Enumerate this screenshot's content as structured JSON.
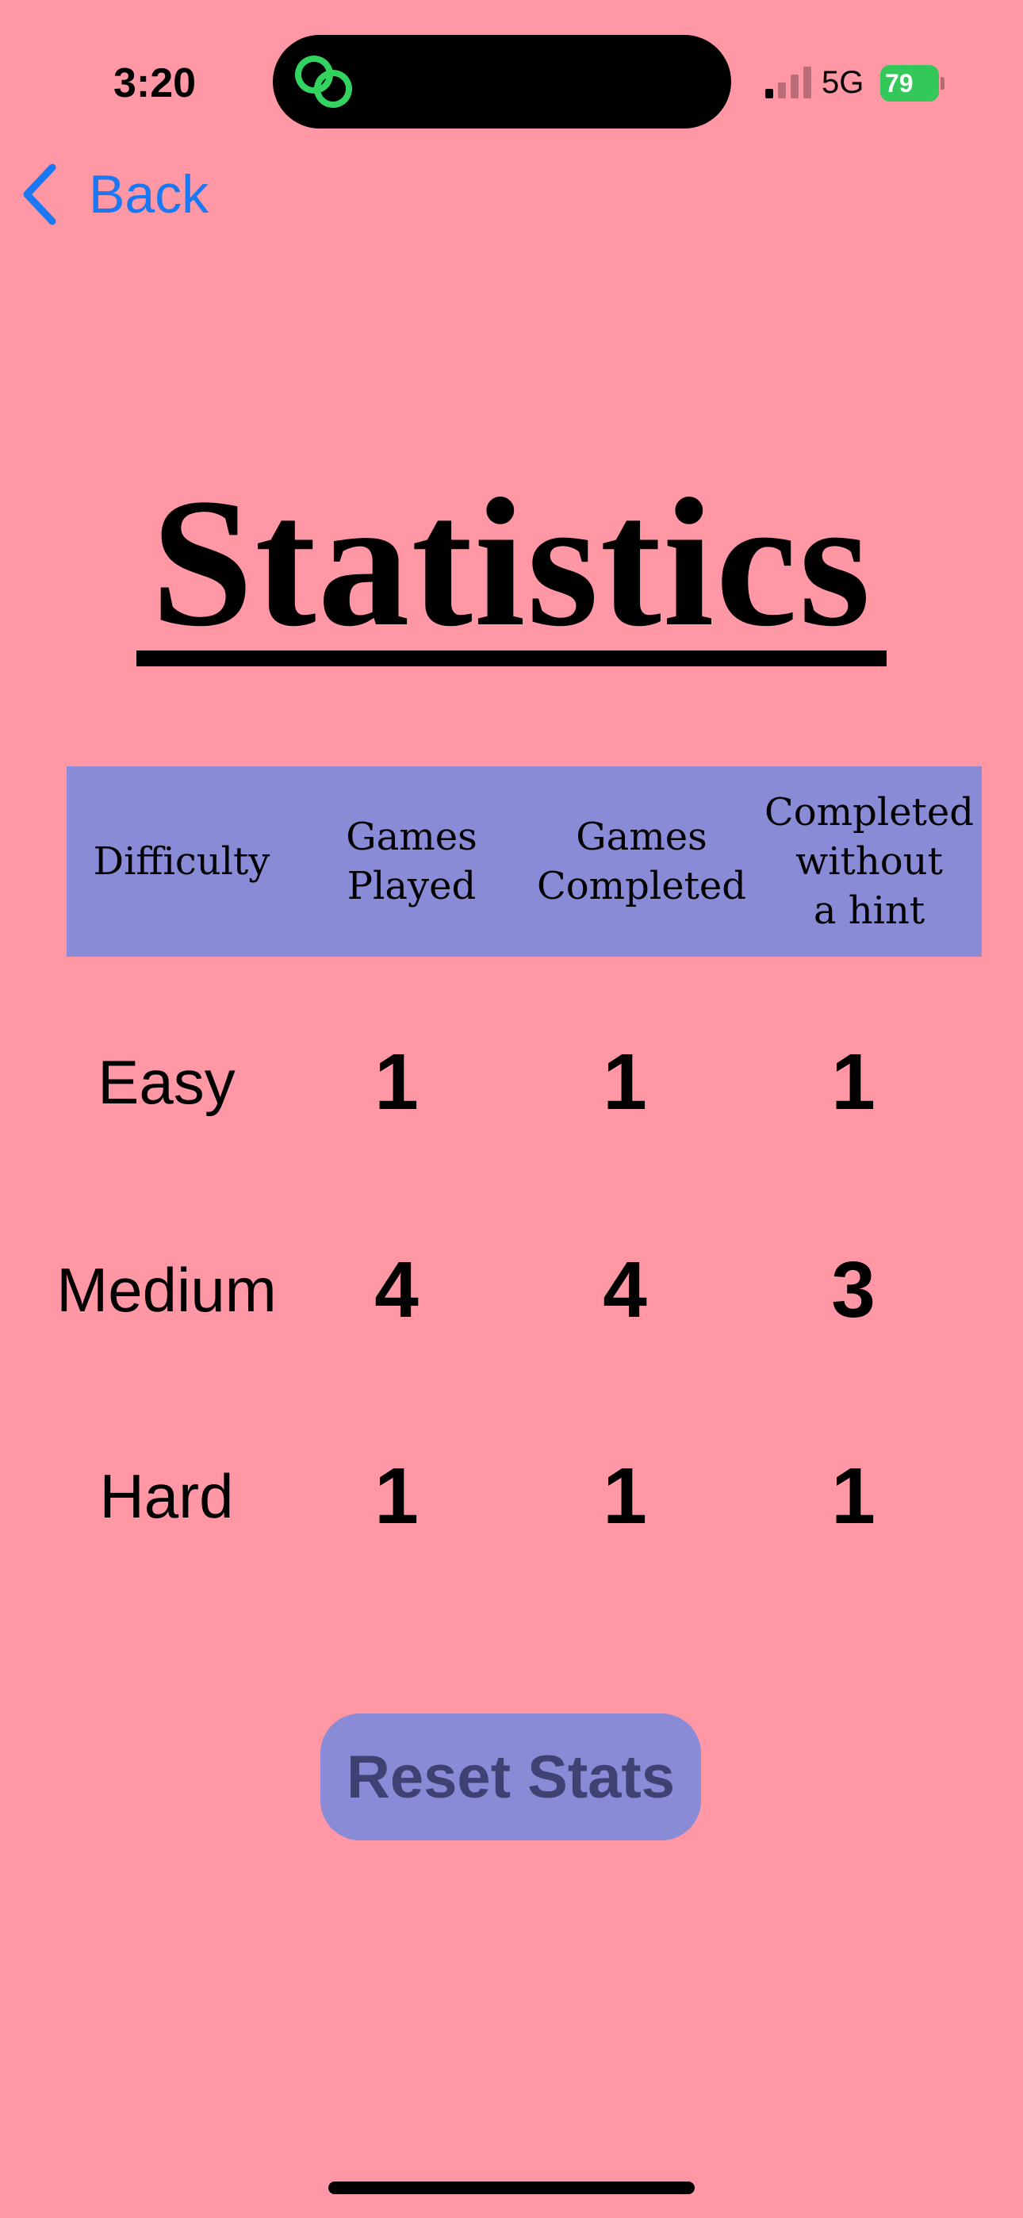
{
  "status_bar": {
    "time": "3:20",
    "network": "5G",
    "battery": "79"
  },
  "nav": {
    "back_label": "Back"
  },
  "title": "Statistics",
  "table": {
    "headers": [
      "Difficulty",
      "Games\nPlayed",
      "Games\nCompleted",
      "Completed\nwithout\na hint"
    ],
    "rows": [
      {
        "difficulty": "Easy",
        "games_played": "1",
        "games_completed": "1",
        "completed_without_hint": "1"
      },
      {
        "difficulty": "Medium",
        "games_played": "4",
        "games_completed": "4",
        "completed_without_hint": "3"
      },
      {
        "difficulty": "Hard",
        "games_played": "1",
        "games_completed": "1",
        "completed_without_hint": "1"
      }
    ]
  },
  "reset_button": {
    "label": "Reset Stats"
  },
  "colors": {
    "background": "#ff97a5",
    "accent": "#8a8bd6",
    "link": "#1a78f2",
    "battery": "#34c759",
    "island_icon": "#33d35f"
  },
  "icons": {
    "island": "linked-rings-icon",
    "signal": "cellular-signal-icon",
    "battery": "battery-charging-icon",
    "back": "chevron-left-icon"
  }
}
